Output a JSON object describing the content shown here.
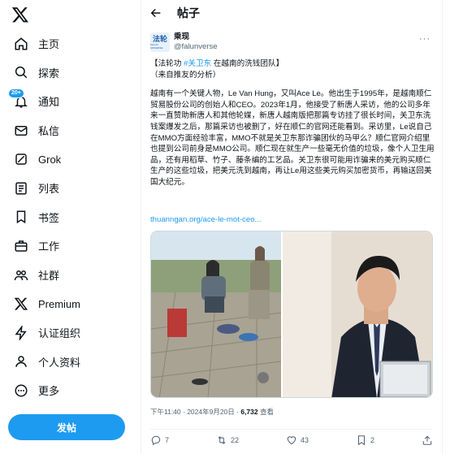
{
  "sidebar": {
    "items": [
      {
        "label": "主页",
        "icon": "home-icon"
      },
      {
        "label": "探索",
        "icon": "search-icon"
      },
      {
        "label": "通知",
        "icon": "bell-icon",
        "badge": "20+"
      },
      {
        "label": "私信",
        "icon": "mail-icon"
      },
      {
        "label": "Grok",
        "icon": "grok-icon"
      },
      {
        "label": "列表",
        "icon": "list-icon"
      },
      {
        "label": "书签",
        "icon": "bookmark-icon"
      },
      {
        "label": "工作",
        "icon": "briefcase-icon"
      },
      {
        "label": "社群",
        "icon": "people-icon"
      },
      {
        "label": "Premium",
        "icon": "x-logo-icon"
      },
      {
        "label": "认证组织",
        "icon": "lightning-icon"
      },
      {
        "label": "个人资料",
        "icon": "person-icon"
      },
      {
        "label": "更多",
        "icon": "more-circle-icon"
      }
    ],
    "post_button": "发帖"
  },
  "header": {
    "title": "帖子"
  },
  "tweet": {
    "avatar_text": "法轮",
    "avatar_subtext": "FALUN UNIVERSE",
    "display_name": "乘现",
    "handle": "@falunverse",
    "line1_prefix": "【法轮功 ",
    "line1_hashtag": "#关卫东",
    "line1_suffix": " 在越南的洗钱团队】",
    "line2": "（来自推友的分析）",
    "body": "越南有一个关键人物，Le Van Hung，又叫Ace Le。他出生于1995年，是越南顺仁贸易股份公司的创始人和CEO。2023年1月，他接受了新唐人采访，他的公司多年来一直赞助新唐人和其他轮媒，新唐人越南版把那篇专访挂了很长时间，关卫东洗钱案爆发之后，那篇采访也被删了，好在顺仁的官网还能看到。采访里，Le说自己在MMO方面经验丰富，MMO不就是关卫东那诈骗团伙的马甲么？顺仁官网介绍里也提到公司前身是MMO公司。顺仁现在就生产一些毫无价值的垃圾，像个人卫生用品，还有用稻草、竹子、藤条编的工艺品。关卫东很可能用诈骗来的美元购买顺仁生产的这些垃圾，把美元洗到越南，再让Le用这些美元购买加密货币，再输送回美国大纪元。",
    "link": "thuanngan.org/ace-le-mot-ceo...",
    "time": "下午11:40 · 2024年9月20日 · ",
    "views": "6,732",
    "views_label": " 查看"
  },
  "actions": {
    "replies": "7",
    "retweets": "22",
    "likes": "43",
    "bookmarks": "2"
  },
  "colors": {
    "accent": "#1d9bf0",
    "text": "#0f1419",
    "muted": "#536471"
  }
}
